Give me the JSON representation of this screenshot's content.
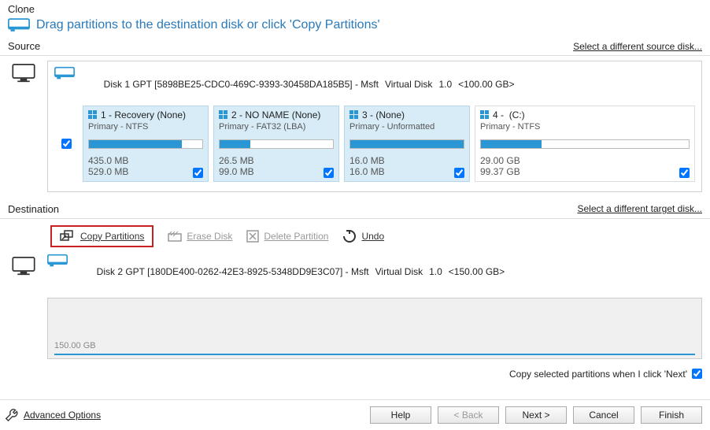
{
  "header": {
    "title": "Clone"
  },
  "hint": "Drag partitions to the destination disk or click 'Copy Partitions'",
  "source": {
    "label": "Source",
    "different_link": "Select a different source disk...",
    "disk": {
      "id": "Disk 1 GPT [5898BE25-CDC0-469C-9393-30458DA185B5] - Msft",
      "type": "Virtual Disk",
      "bus": "1.0",
      "size": "<100.00 GB>"
    },
    "partitions": [
      {
        "num": "1",
        "name": "Recovery (None)",
        "fs": "Primary - NTFS",
        "used": "435.0 MB",
        "total": "529.0 MB",
        "fill": 82,
        "checked": true
      },
      {
        "num": "2",
        "name": "NO NAME (None)",
        "fs": "Primary - FAT32 (LBA)",
        "used": "26.5 MB",
        "total": "99.0 MB",
        "fill": 27,
        "checked": true
      },
      {
        "num": "3",
        "name": "(None)",
        "fs": "Primary - Unformatted",
        "used": "16.0 MB",
        "total": "16.0 MB",
        "fill": 100,
        "checked": true
      },
      {
        "num": "4",
        "name": "(C:)",
        "fs": "Primary - NTFS",
        "used": "29.00 GB",
        "total": "99.37 GB",
        "fill": 29,
        "checked": true,
        "light": true
      }
    ]
  },
  "destination": {
    "label": "Destination",
    "different_link": "Select a different target disk...",
    "toolbar": {
      "copy": "Copy Partitions",
      "erase": "Erase Disk",
      "delete": "Delete Partition",
      "undo": "Undo"
    },
    "disk": {
      "id": "Disk 2 GPT [180DE400-0262-42E3-8925-5348DD9E3C07] - Msft",
      "type": "Virtual Disk",
      "bus": "1.0",
      "size": "<150.00 GB>"
    },
    "free_size": "150.00 GB"
  },
  "copy_next": {
    "label": "Copy selected partitions when I click 'Next'",
    "checked": true
  },
  "footer": {
    "advanced": "Advanced Options",
    "help": "Help",
    "back": "< Back",
    "next": "Next >",
    "cancel": "Cancel",
    "finish": "Finish"
  }
}
